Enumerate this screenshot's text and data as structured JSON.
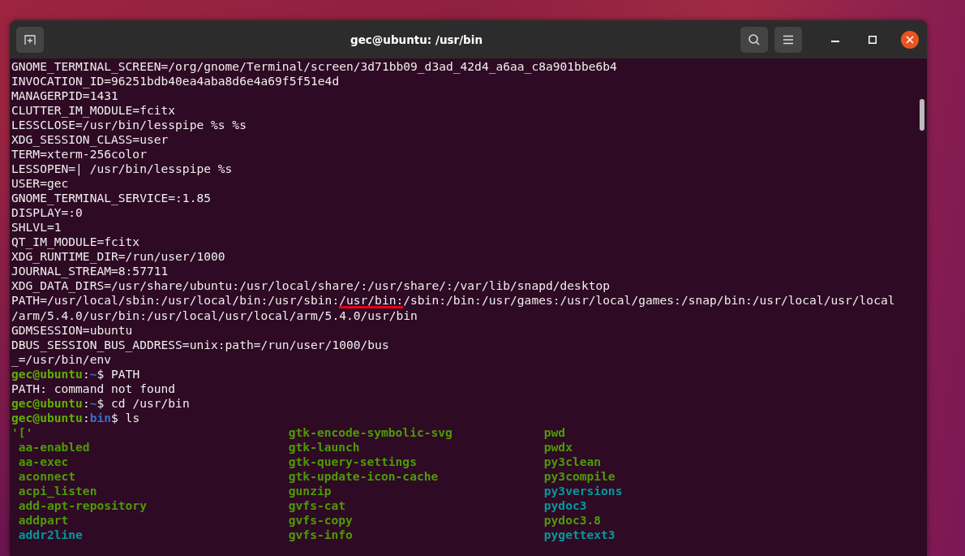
{
  "window": {
    "title": "gec@ubuntu: /usr/bin"
  },
  "lines": [
    {
      "kind": "output",
      "text": "GNOME_TERMINAL_SCREEN=/org/gnome/Terminal/screen/3d71bb09_d3ad_42d4_a6aa_c8a901bbe6b4"
    },
    {
      "kind": "output",
      "text": "INVOCATION_ID=96251bdb40ea4aba8d6e4a69f5f51e4d"
    },
    {
      "kind": "output",
      "text": "MANAGERPID=1431"
    },
    {
      "kind": "output",
      "text": "CLUTTER_IM_MODULE=fcitx"
    },
    {
      "kind": "output",
      "text": "LESSCLOSE=/usr/bin/lesspipe %s %s"
    },
    {
      "kind": "output",
      "text": "XDG_SESSION_CLASS=user"
    },
    {
      "kind": "output",
      "text": "TERM=xterm-256color"
    },
    {
      "kind": "output",
      "text": "LESSOPEN=| /usr/bin/lesspipe %s"
    },
    {
      "kind": "output",
      "text": "USER=gec"
    },
    {
      "kind": "output",
      "text": "GNOME_TERMINAL_SERVICE=:1.85"
    },
    {
      "kind": "output",
      "text": "DISPLAY=:0"
    },
    {
      "kind": "output",
      "text": "SHLVL=1"
    },
    {
      "kind": "output",
      "text": "QT_IM_MODULE=fcitx"
    },
    {
      "kind": "output",
      "text": "XDG_RUNTIME_DIR=/run/user/1000"
    },
    {
      "kind": "output",
      "text": "JOURNAL_STREAM=8:57711"
    },
    {
      "kind": "output",
      "text": "XDG_DATA_DIRS=/usr/share/ubuntu:/usr/local/share/:/usr/share/:/var/lib/snapd/desktop"
    },
    {
      "kind": "underlined",
      "before": "PATH=/usr/local/sbin:/usr/local/bin:/usr/sbin:",
      "marked": "/usr/bin:",
      "after": "/sbin:/bin:/usr/games:/usr/local/games:/snap/bin:/usr/local/usr/local"
    },
    {
      "kind": "output",
      "text": "/arm/5.4.0/usr/bin:/usr/local/usr/local/arm/5.4.0/usr/bin"
    },
    {
      "kind": "output",
      "text": "GDMSESSION=ubuntu"
    },
    {
      "kind": "output",
      "text": "DBUS_SESSION_BUS_ADDRESS=unix:path=/run/user/1000/bus"
    },
    {
      "kind": "output",
      "text": "_=/usr/bin/env"
    },
    {
      "kind": "prompt",
      "user": "gec@ubuntu",
      "sep": ":",
      "dir": "~",
      "command": "$ PATH"
    },
    {
      "kind": "output",
      "text": "PATH: command not found"
    },
    {
      "kind": "prompt",
      "user": "gec@ubuntu",
      "sep": ":",
      "dir": "~",
      "command": "$ cd /usr/bin"
    },
    {
      "kind": "prompt",
      "user": "gec@ubuntu",
      "sep": ":",
      "dir": "bin",
      "command": "$ ls"
    }
  ],
  "listing": [
    [
      {
        "name": "'['",
        "color": "#4e9a06",
        "quoted": true
      },
      {
        "name": "aa-enabled",
        "color": "#4e9a06",
        "quoted": false
      },
      {
        "name": "aa-exec",
        "color": "#4e9a06",
        "quoted": false
      },
      {
        "name": "aconnect",
        "color": "#4e9a06",
        "quoted": false
      },
      {
        "name": "acpi_listen",
        "color": "#4e9a06",
        "quoted": false
      },
      {
        "name": "add-apt-repository",
        "color": "#4e9a06",
        "quoted": false
      },
      {
        "name": "addpart",
        "color": "#4e9a06",
        "quoted": false
      },
      {
        "name": "addr2line",
        "color": "#06989a",
        "quoted": false
      }
    ],
    [
      {
        "name": "gtk-encode-symbolic-svg",
        "color": "#4e9a06",
        "quoted": false
      },
      {
        "name": "gtk-launch",
        "color": "#4e9a06",
        "quoted": false
      },
      {
        "name": "gtk-query-settings",
        "color": "#4e9a06",
        "quoted": false
      },
      {
        "name": "gtk-update-icon-cache",
        "color": "#4e9a06",
        "quoted": false
      },
      {
        "name": "gunzip",
        "color": "#4e9a06",
        "quoted": false
      },
      {
        "name": "gvfs-cat",
        "color": "#4e9a06",
        "quoted": false
      },
      {
        "name": "gvfs-copy",
        "color": "#4e9a06",
        "quoted": false
      },
      {
        "name": "gvfs-info",
        "color": "#4e9a06",
        "quoted": false
      }
    ],
    [
      {
        "name": "pwd",
        "color": "#4e9a06",
        "quoted": false
      },
      {
        "name": "pwdx",
        "color": "#4e9a06",
        "quoted": false
      },
      {
        "name": "py3clean",
        "color": "#4e9a06",
        "quoted": false
      },
      {
        "name": "py3compile",
        "color": "#4e9a06",
        "quoted": false
      },
      {
        "name": "py3versions",
        "color": "#06989a",
        "quoted": false
      },
      {
        "name": "pydoc3",
        "color": "#06989a",
        "quoted": false
      },
      {
        "name": "pydoc3.8",
        "color": "#4e9a06",
        "quoted": false
      },
      {
        "name": "pygettext3",
        "color": "#06989a",
        "quoted": false
      }
    ]
  ]
}
